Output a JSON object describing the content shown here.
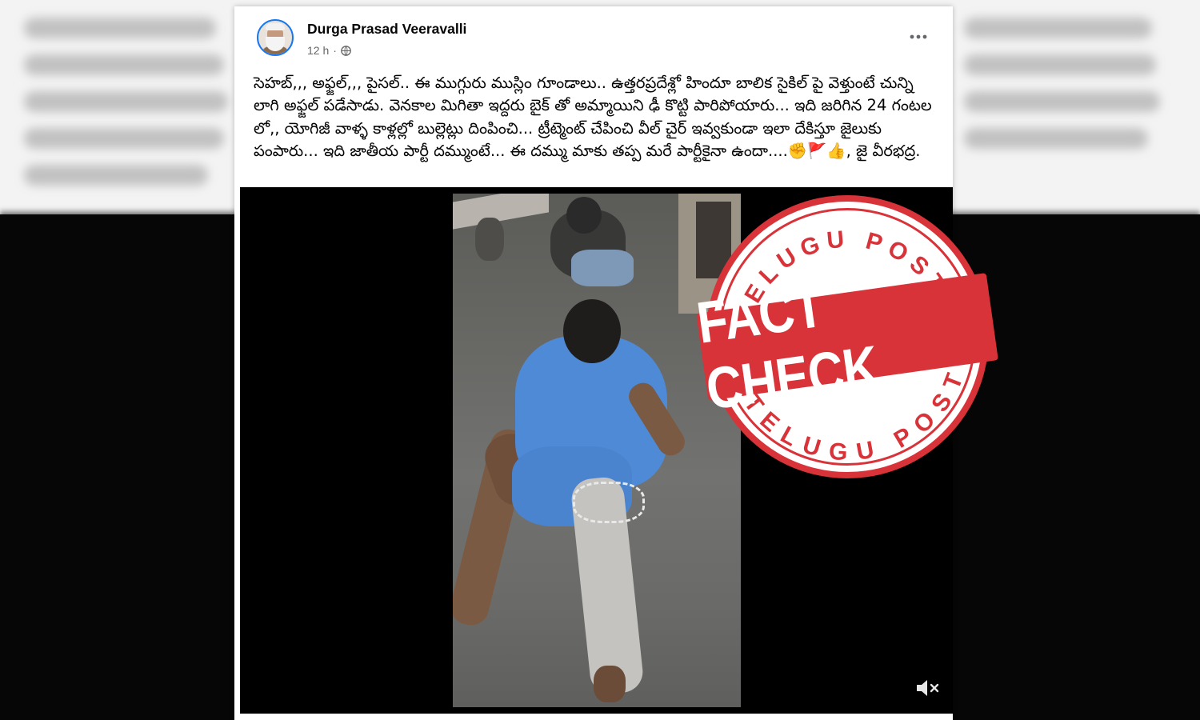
{
  "post": {
    "author_name": "Durga Prasad Veeravalli",
    "timestamp": "12 h",
    "audience_icon": "globe-icon",
    "text": "సెహబ్,,, అఫ్జల్,,, పైసల్.. ఈ ముగ్గురు ముస్లిం  గూండాలు.. ఉత్తరప్రదేశ్లో హిందూ బాలిక సైకిల్ పై వెళ్తుంటే చున్ని లాగి అఫ్జల్ పడేసాడు. వెనకాల మిగితా ఇద్దరు బైక్ తో అమ్మాయిని ఢీ కొట్టి పారిపోయారు... ఇది జరిగిన 24 గంటల లో,, యోగిజీ వాళ్ళ కాళ్లల్లో బుల్లెట్లు దింపించి... ట్రీట్మెంట్ చేపించి వీల్ చైర్ ఇవ్వకుండా ఇలా దేకిస్తూ జైలుకు పంపారు... ఇది జాతీయ పార్టీ దమ్ముంటే... ఈ దమ్ము మాకు తప్ప మరే పార్టీకైనా ఉందా....✊🚩👍, జై వీరభద్ర."
  },
  "stamp": {
    "top_text": "TELUGU POST",
    "center_text": "FACT CHECK",
    "bottom_text": "TELUGU POST",
    "color": "#d9333a"
  },
  "colors": {
    "facebook_blue": "#1877f2",
    "text_primary": "#050505",
    "text_secondary": "#65676b"
  }
}
